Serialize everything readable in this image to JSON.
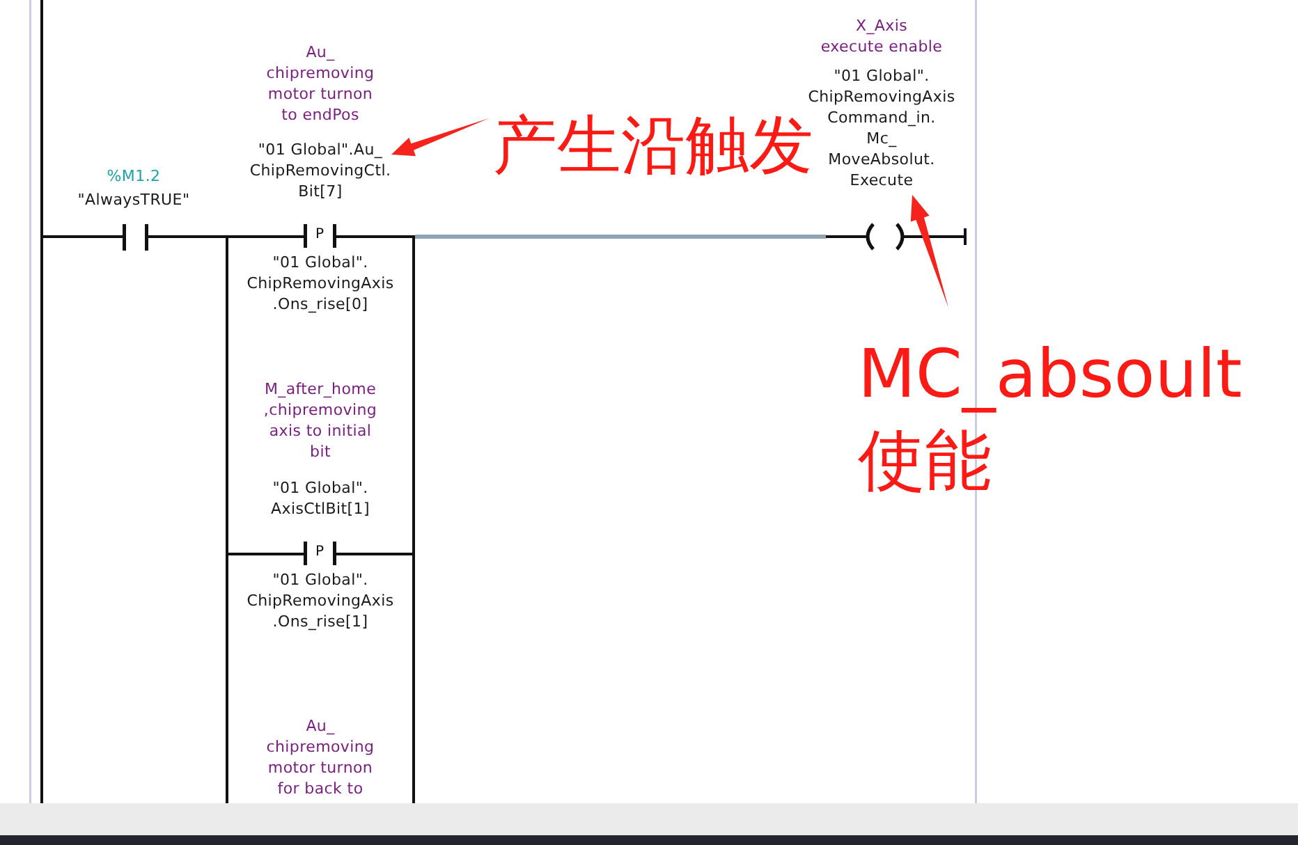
{
  "editor": {
    "input_contact": {
      "kind": "normally_open",
      "address": "%M1.2",
      "tag": "\"AlwaysTRUE\""
    },
    "branches": [
      {
        "comment": "Au_\nchipremoving\nmotor turnon\nto endPos",
        "operand": "\"01 Global\".Au_\nChipRemovingCtl.\nBit[7]",
        "contact": {
          "kind": "positive_edge",
          "label": "P"
        },
        "edge_bit": "\"01 Global\".\nChipRemovingAxis\n.Ons_rise[0]"
      },
      {
        "comment": "M_after_home\n,chipremoving\naxis to initial\nbit",
        "operand": "\"01 Global\".\nAxisCtlBit[1]",
        "contact": {
          "kind": "positive_edge",
          "label": "P"
        },
        "edge_bit": "\"01 Global\".\nChipRemovingAxis\n.Ons_rise[1]"
      },
      {
        "comment": "Au_\nchipremoving\nmotor turnon\nfor back to"
      }
    ],
    "output_wire": {
      "selected": true
    },
    "coil": {
      "kind": "output",
      "comment": "X_Axis\nexecute enable",
      "operand": "\"01 Global\".\nChipRemovingAxis\nCommand_in.\nMc_\nMoveAbsolut.\nExecute"
    }
  },
  "annotations": [
    {
      "text": "产生沿触发"
    },
    {
      "text": "MC_absoult\n使能"
    }
  ]
}
